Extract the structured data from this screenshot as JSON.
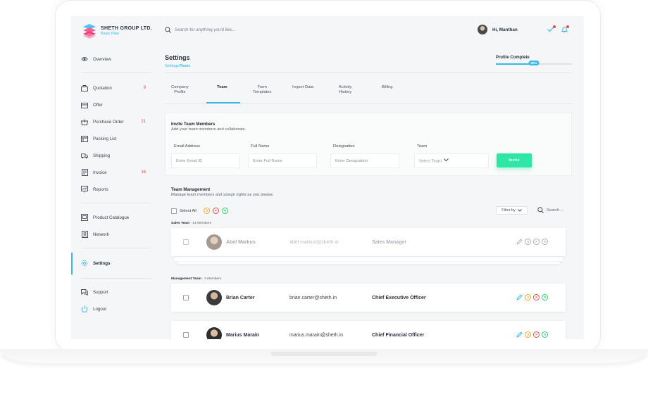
{
  "brand": {
    "name": "SHETH GROUP LTD.",
    "plan": "Basic Plan"
  },
  "search": {
    "placeholder": "Search for anything you'd like..."
  },
  "user": {
    "greeting": "Hi, Manthan"
  },
  "sidebar": {
    "items": [
      {
        "label": "Overview",
        "icon": "eye-icon"
      },
      {
        "label": "Quotation",
        "icon": "quotation-icon",
        "count": "9"
      },
      {
        "label": "Offer",
        "icon": "offer-icon"
      },
      {
        "label": "Purchase Order",
        "icon": "purchase-order-icon",
        "count": "21"
      },
      {
        "label": "Packing List",
        "icon": "packing-list-icon"
      },
      {
        "label": "Shipping",
        "icon": "shipping-icon"
      },
      {
        "label": "Invoice",
        "icon": "invoice-icon",
        "count": "16"
      },
      {
        "label": "Reports",
        "icon": "reports-icon"
      },
      {
        "label": "Product Catalogue",
        "icon": "catalogue-icon"
      },
      {
        "label": "Network",
        "icon": "network-icon"
      },
      {
        "label": "Settings",
        "icon": "gear-icon",
        "active": true
      },
      {
        "label": "Support",
        "icon": "support-icon"
      },
      {
        "label": "Logout",
        "icon": "power-icon"
      }
    ]
  },
  "page": {
    "title": "Settings",
    "crumb_parent": "Settings/",
    "crumb_current": "Team"
  },
  "profile": {
    "label": "Profile Complete",
    "percent_text": "50%",
    "percent": 50
  },
  "tabs": [
    {
      "line1": "Company",
      "line2": "Profile"
    },
    {
      "line1": "Team",
      "line2": "",
      "active": true
    },
    {
      "line1": "Form",
      "line2": "Templates"
    },
    {
      "line1": "Import Data",
      "line2": ""
    },
    {
      "line1": "Activity",
      "line2": "History"
    },
    {
      "line1": "Billing",
      "line2": ""
    }
  ],
  "invite": {
    "title": "Invite Team Members",
    "subtitle": "Add your team members and collaborate.",
    "fields": [
      {
        "label": "Email Address",
        "placeholder": "Enter Email ID"
      },
      {
        "label": "Full Name",
        "placeholder": "Enter Full Name"
      },
      {
        "label": "Designation",
        "placeholder": "Enter Designation"
      },
      {
        "label": "Team",
        "placeholder": "Select Team"
      }
    ],
    "button": "Invite"
  },
  "team_management": {
    "title": "Team Management",
    "subtitle": "Manage team members and assign rights as you please.",
    "select_all": "Select All",
    "filter": "Filter by",
    "search": "Search..."
  },
  "groups": [
    {
      "name": "Sales Team",
      "count": "14 Members",
      "members": [
        {
          "name": "Abel Markus",
          "email": "abel.markus@sheth.in",
          "role": "Sales Manager"
        }
      ]
    },
    {
      "name": "Management Team",
      "count": "3 Members",
      "members": [
        {
          "name": "Brian Carter",
          "email": "brian.carter@sheth.in",
          "role": "Chief Executive Officer"
        },
        {
          "name": "Marius Marain",
          "email": "marius.marain@sheth.in",
          "role": "Chief Financial Officer"
        }
      ]
    }
  ],
  "colors": {
    "accent": "#3ab8e8",
    "invite": "#2ee6a6",
    "danger": "#e54b4b",
    "warning": "#f5a623",
    "success": "#2ecc71"
  }
}
